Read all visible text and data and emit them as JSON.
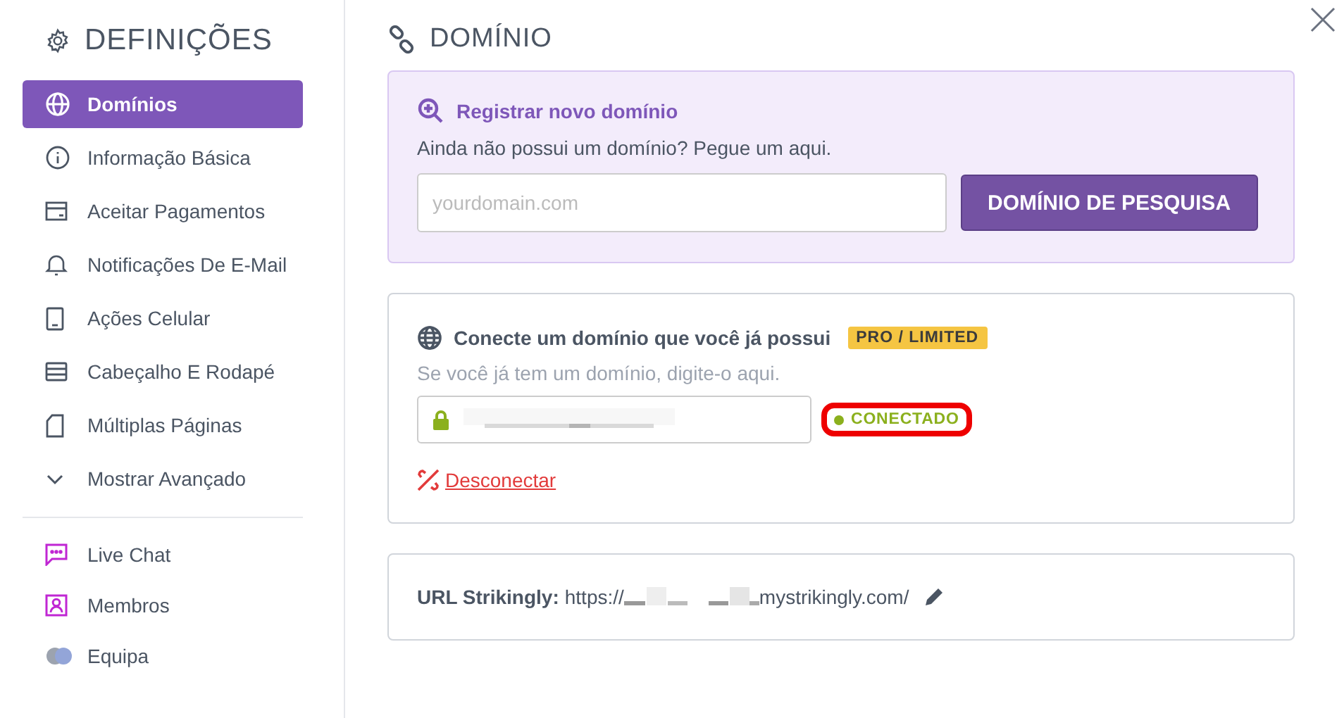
{
  "sidebar": {
    "title": "DEFINIÇÕES",
    "items": [
      {
        "label": "Domínios",
        "selected": true
      },
      {
        "label": "Informação Básica",
        "selected": false
      },
      {
        "label": "Aceitar Pagamentos",
        "selected": false
      },
      {
        "label": "Notificações De E-Mail",
        "selected": false
      },
      {
        "label": "Ações Celular",
        "selected": false
      },
      {
        "label": "Cabeçalho E Rodapé",
        "selected": false
      },
      {
        "label": "Múltiplas Páginas",
        "selected": false
      },
      {
        "label": "Mostrar Avançado",
        "selected": false
      }
    ],
    "extras": [
      {
        "label": "Live Chat"
      },
      {
        "label": "Membros"
      },
      {
        "label": "Equipa"
      }
    ]
  },
  "main": {
    "title": "DOMÍNIO",
    "register": {
      "heading": "Registrar novo domínio",
      "text": "Ainda não possui um domínio? Pegue um aqui.",
      "placeholder": "yourdomain.com",
      "button": "DOMÍNIO DE PESQUISA"
    },
    "connect": {
      "heading": "Conecte um domínio que você já possui",
      "badge": "PRO / LIMITED",
      "text": "Se você já tem um domínio, digite-o aqui.",
      "status": "CONECTADO",
      "connected": true,
      "highlighted": true,
      "link": "Desconectar"
    },
    "url": {
      "label": "URL Strikingly:",
      "prefix": "https://",
      "suffix": "mystrikingly.com/"
    }
  }
}
